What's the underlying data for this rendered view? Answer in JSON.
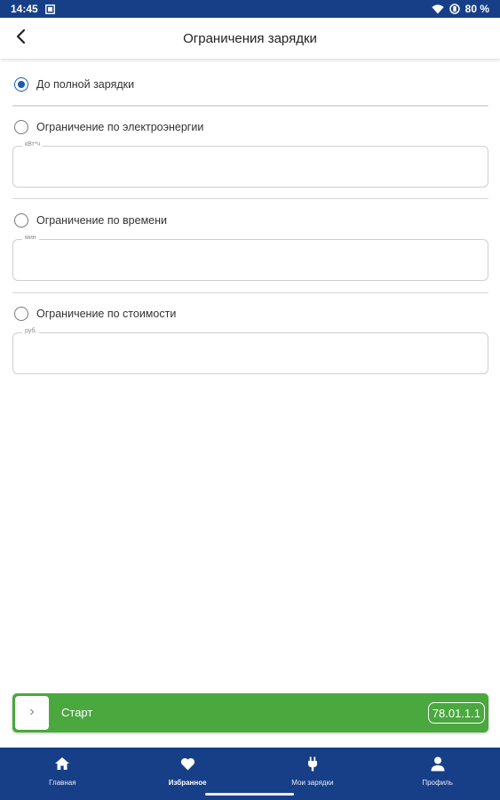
{
  "status_bar": {
    "time": "14:45",
    "battery": "80 %",
    "bg_color": "#173f88"
  },
  "header": {
    "title": "Ограничения зарядки",
    "back_icon": "chevron-left-icon"
  },
  "options": [
    {
      "label": "До полной зарядки",
      "checked": true
    },
    {
      "label": "Ограничение по электроэнергии",
      "checked": false,
      "field_label": "кВт*ч",
      "field_value": ""
    },
    {
      "label": "Ограничение по времени",
      "checked": false,
      "field_label": "мин",
      "field_value": ""
    },
    {
      "label": "Ограничение по стоимости",
      "checked": false,
      "field_label": "руб.",
      "field_value": ""
    }
  ],
  "start_bar": {
    "knob_icon": "chevron-right-icon",
    "label": "Старт",
    "station_code": "78.01.1.1",
    "color": "#4aa83f"
  },
  "bottom_nav": {
    "items": [
      {
        "label": "Главная",
        "icon": "home-icon",
        "active": false
      },
      {
        "label": "Избранное",
        "icon": "heart-icon",
        "active": true
      },
      {
        "label": "Мои зарядки",
        "icon": "plug-icon",
        "active": false
      },
      {
        "label": "Профиль",
        "icon": "person-icon",
        "active": false
      }
    ],
    "bg_color": "#173f88"
  },
  "colors": {
    "accent": "#1a5bb5",
    "primary_dark": "#173f88",
    "success": "#4aa83f"
  }
}
